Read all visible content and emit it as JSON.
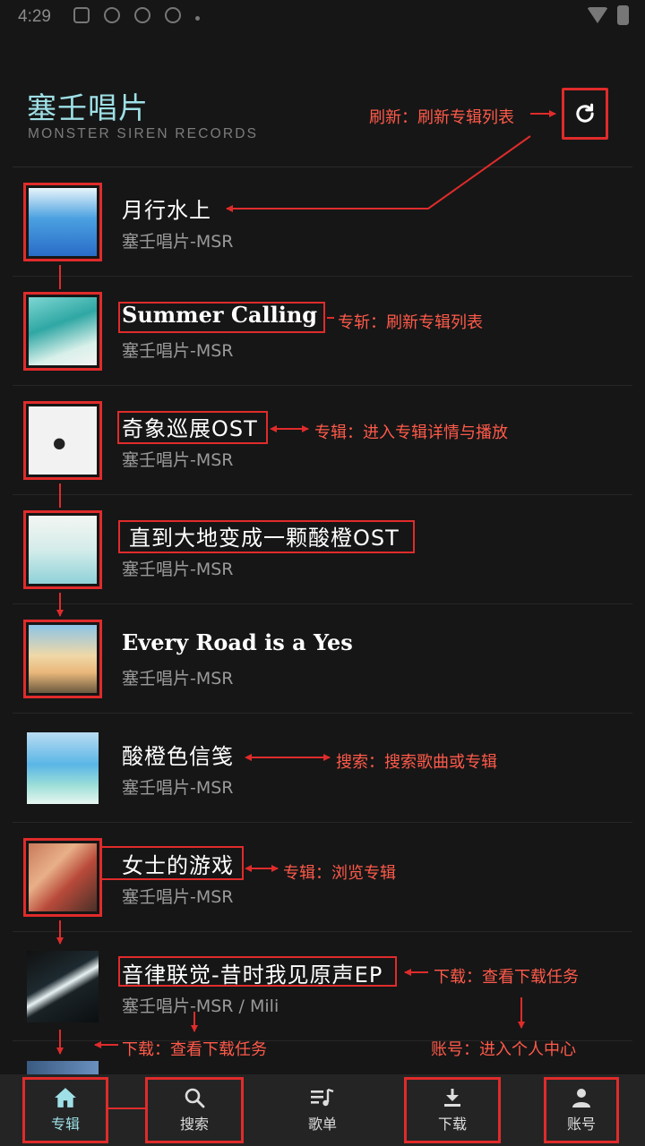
{
  "status_bar": {
    "time": "4:29"
  },
  "header": {
    "title": "塞壬唱片",
    "subtitle": "MONSTER SIREN RECORDS"
  },
  "albums": [
    {
      "title": "月行水上",
      "artist": "塞壬唱片-MSR"
    },
    {
      "title": "Summer Calling",
      "artist": "塞壬唱片-MSR"
    },
    {
      "title": "奇象巡展OST",
      "artist": "塞壬唱片-MSR"
    },
    {
      "title": "直到大地变成一颗酸橙OST",
      "artist": "塞壬唱片-MSR"
    },
    {
      "title": "Every Road is a Yes",
      "artist": "塞壬唱片-MSR"
    },
    {
      "title": "酸橙色信笺",
      "artist": "塞壬唱片-MSR"
    },
    {
      "title": "女士的游戏",
      "artist": "塞壬唱片-MSR"
    },
    {
      "title": "音律联觉-昔时我见原声EP",
      "artist": "塞壬唱片-MSR / Mili"
    }
  ],
  "annotations": {
    "refresh": "刷新：刷新专辑列表",
    "summer": "专斩：刷新专辑列表",
    "album_detail": "专辑：进入专辑详情与播放",
    "search": "搜索：搜索歌曲或专辑",
    "browse": "专辑：浏览专辑",
    "download_row": "下载：查看下载任务",
    "download_bottom": "下载：查看下载任务",
    "account": "账号：进入个人中心"
  },
  "nav": [
    {
      "label": "专辑",
      "icon": "home-icon"
    },
    {
      "label": "搜索",
      "icon": "search-icon"
    },
    {
      "label": "歌单",
      "icon": "playlist-icon"
    },
    {
      "label": "下载",
      "icon": "download-icon"
    },
    {
      "label": "账号",
      "icon": "account-icon"
    }
  ],
  "colors": {
    "accent": "#9ee0e6",
    "annotation": "#e02b2b",
    "background": "#161616",
    "nav_background": "#242424"
  }
}
